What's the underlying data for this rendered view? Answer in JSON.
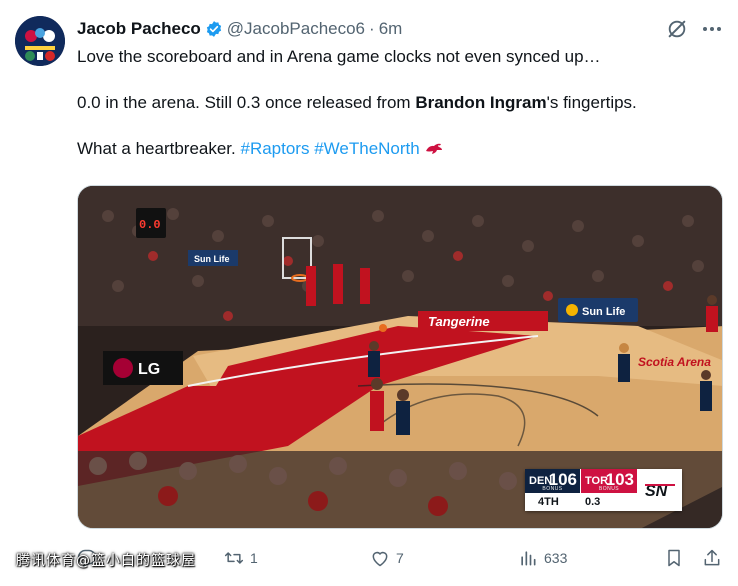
{
  "author": {
    "display_name": "Jacob Pacheco",
    "handle": "@JacobPacheco6",
    "separator": "·",
    "timestamp": "6m"
  },
  "tweet": {
    "line1": "Love the scoreboard and in Arena game clocks not even synced up…",
    "line2_pre": "0.0 in the arena. Still 0.3 once released from ",
    "line2_bold": "Brandon Ingram",
    "line2_post": "'s fingertips.",
    "line3_pre": "What a heartbreaker. ",
    "hashtag1": "#Raptors",
    "hashtag2": "#WeTheNorth"
  },
  "media": {
    "arena_clock": "0.0",
    "ad_sunlife_1": "Sun Life",
    "ad_sunlife_2": "Sun Life",
    "ad_lg": "LG",
    "ad_tangerine": "Tangerine",
    "ad_scotia": "Scotia Arena",
    "scoreboard": {
      "team_away": "DEN",
      "score_away": "106",
      "team_home": "TOR",
      "score_home": "103",
      "bonus_label": "BONUS",
      "period": "4TH",
      "clock": "0.3",
      "network": "SN"
    }
  },
  "actions": {
    "replies": "",
    "retweets": "1",
    "likes": "7",
    "views": "633"
  },
  "watermark": "腾讯体育@篮小白的篮球屋",
  "colors": {
    "text": "#0f1419",
    "muted": "#536471",
    "link": "#1d9bf0",
    "raptors_red": "#ce1141",
    "nuggets_navy": "#0e2240"
  }
}
